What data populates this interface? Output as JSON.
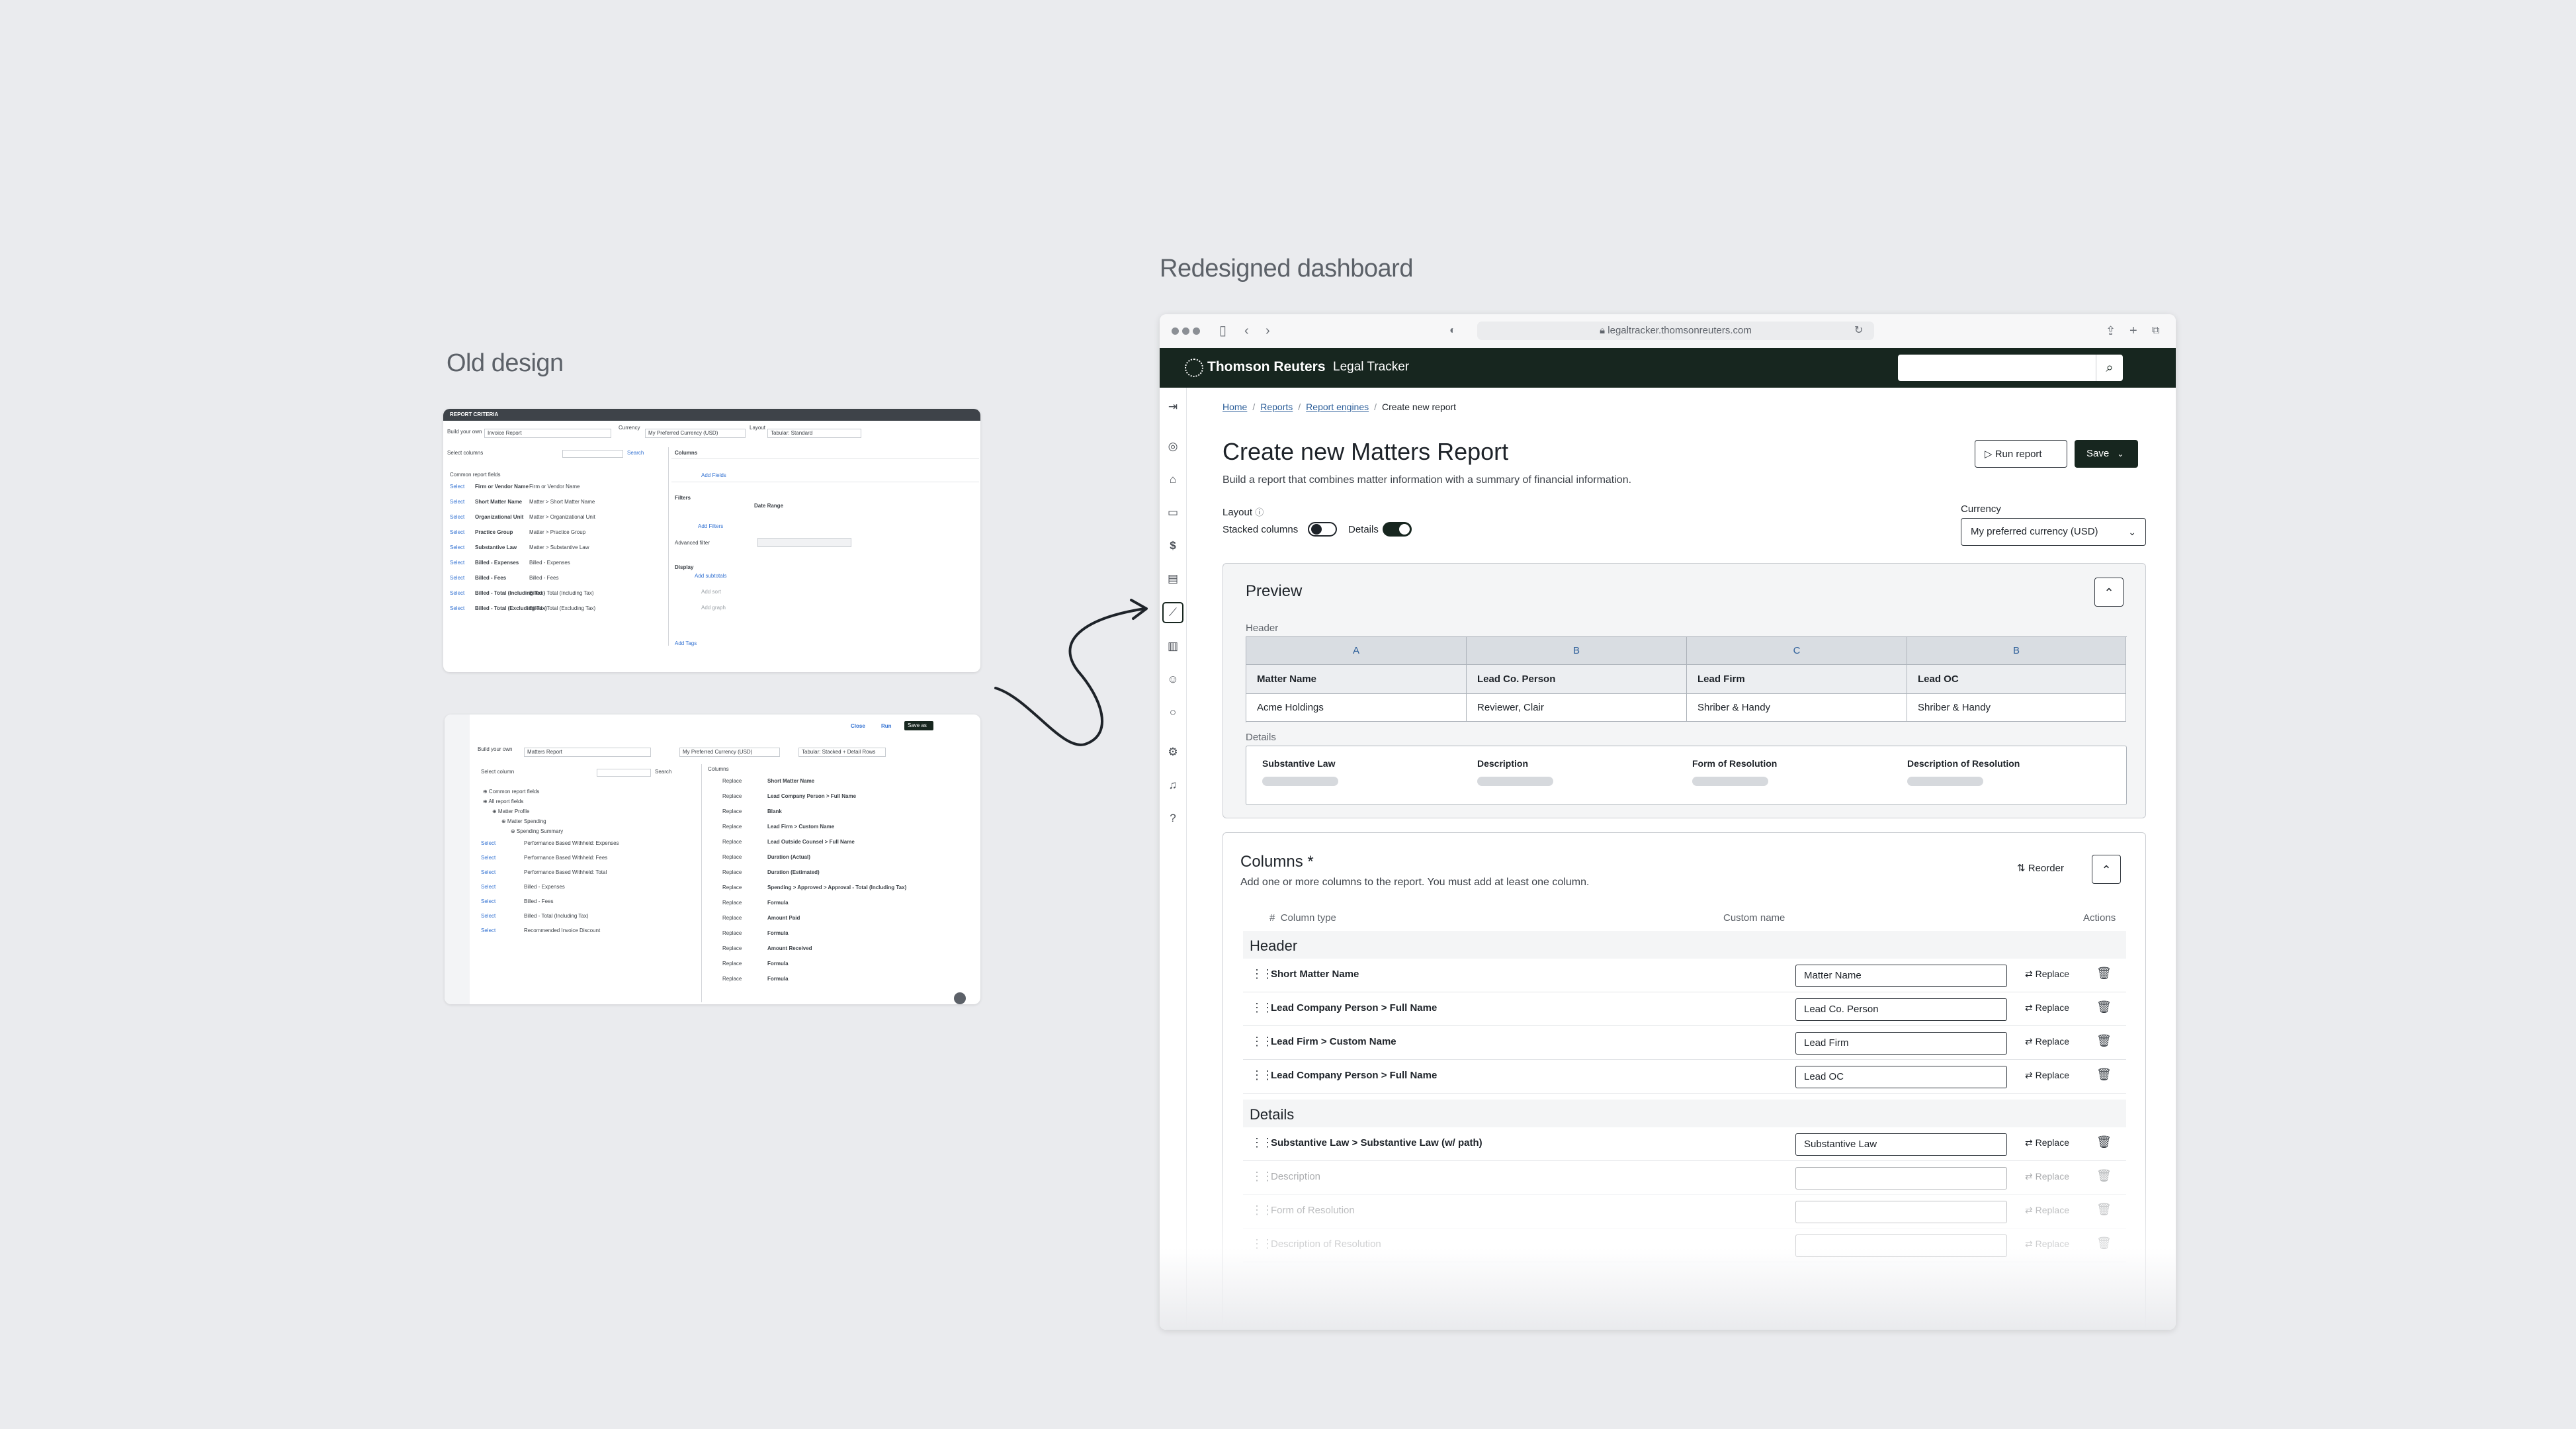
{
  "labels": {
    "old_design": "Old design",
    "redesigned": "Redesigned dashboard"
  },
  "old_top": {
    "header": "REPORT CRITERIA",
    "build_label": "Build your own",
    "report_value": "Invoice Report",
    "currency_label": "Currency",
    "currency_value": "My Preferred Currency (USD)",
    "layout_label": "Layout",
    "layout_value": "Tabular: Standard",
    "select_columns": "Select columns",
    "search": "Search",
    "common_fields": "Common report fields",
    "columns_label": "Columns",
    "add_fields": "Add Fields",
    "filters_label": "Filters",
    "date_range": "Date Range",
    "add_filters": "Add Filters",
    "advanced_filter": "Advanced filter",
    "display_label": "Display",
    "add_subtotals": "Add subtotals",
    "add_sort": "Add sort",
    "add_graph": "Add graph",
    "add_tags": "Add Tags",
    "rows": [
      {
        "name": "Firm or Vendor Name",
        "path": "Firm or Vendor Name"
      },
      {
        "name": "Short Matter Name",
        "path": "Matter > Short Matter Name"
      },
      {
        "name": "Organizational Unit",
        "path": "Matter > Organizational Unit"
      },
      {
        "name": "Practice Group",
        "path": "Matter > Practice Group"
      },
      {
        "name": "Substantive Law",
        "path": "Matter > Substantive Law"
      },
      {
        "name": "Billed - Expenses",
        "path": "Billed - Expenses"
      },
      {
        "name": "Billed - Fees",
        "path": "Billed - Fees"
      },
      {
        "name": "Billed - Total (Including Tax)",
        "path": "Billed - Total (Including Tax)"
      },
      {
        "name": "Billed - Total (Excluding Tax)",
        "path": "Billed - Total (Excluding Tax)"
      }
    ]
  },
  "old_bottom": {
    "close": "Close",
    "run": "Run",
    "save_as": "Save as",
    "build_label": "Build your own",
    "report_value": "Matters Report",
    "currency_value": "My Preferred Currency (USD)",
    "layout_value": "Tabular: Stacked + Detail Rows",
    "select_column": "Select column",
    "search": "Search",
    "tree": [
      "Common report fields",
      "All report fields",
      "Matter Profile",
      "Matter Spending",
      "Spending Summary"
    ],
    "left_rows": [
      "Performance Based Withheld: Expenses",
      "Performance Based Withheld: Fees",
      "Performance Based Withheld: Total",
      "Billed - Expenses",
      "Billed - Fees",
      "Billed - Total (Including Tax)",
      "Recommended Invoice Discount"
    ],
    "columns_label": "Columns",
    "replace": "Replace",
    "right_rows": [
      "Short Matter Name",
      "Lead Company Person > Full Name",
      "Blank",
      "Lead Firm > Custom Name",
      "Lead Outside Counsel > Full Name",
      "Duration (Actual)",
      "Duration (Estimated)",
      "Spending > Approved > Approval - Total (Including Tax)",
      "Formula",
      "Amount Paid",
      "Formula",
      "Amount Received",
      "Formula",
      "Formula"
    ]
  },
  "browser": {
    "url": "legaltracker.thomsonreuters.com",
    "brand": "Thomson Reuters",
    "app_name": "Legal Tracker",
    "search_placeholder": ""
  },
  "breadcrumb": [
    "Home",
    "Reports",
    "Report engines"
  ],
  "breadcrumb_current": "Create new report",
  "page": {
    "title": "Create new Matters Report",
    "subtitle": "Build a report that combines matter information with a summary of financial information.",
    "run_report": "Run report",
    "save": "Save",
    "layout_label": "Layout",
    "stacked_columns": "Stacked columns",
    "details": "Details",
    "currency_label": "Currency",
    "currency_value": "My preferred currency (USD)"
  },
  "preview": {
    "title": "Preview",
    "header_label": "Header",
    "letters": [
      "A",
      "B",
      "C",
      "B"
    ],
    "headers": [
      "Matter Name",
      "Lead Co. Person",
      "Lead Firm",
      "Lead OC"
    ],
    "values": [
      "Acme Holdings",
      "Reviewer, Clair",
      "Shriber & Handy",
      "Shriber & Handy"
    ],
    "details_label": "Details",
    "detail_headers": [
      "Substantive Law",
      "Description",
      "Form of Resolution",
      "Description of Resolution"
    ]
  },
  "columns": {
    "title": "Columns *",
    "subtitle": "Add one or more columns to the report. You must add at least one column.",
    "reorder": "Reorder",
    "col_type": "Column type",
    "hash": "#",
    "custom_name": "Custom name",
    "actions": "Actions",
    "header_group": "Header",
    "details_group": "Details",
    "replace": "Replace",
    "header_rows": [
      {
        "type": "Short Matter Name",
        "custom": "Matter Name"
      },
      {
        "type": "Lead Company Person > Full Name",
        "custom": "Lead Co. Person"
      },
      {
        "type": "Lead Firm > Custom Name",
        "custom": "Lead Firm"
      },
      {
        "type": "Lead Company Person > Full Name",
        "custom": "Lead OC"
      }
    ],
    "detail_rows": [
      {
        "type": "Substantive Law > Substantive Law (w/ path)",
        "custom": "Substantive Law"
      },
      {
        "type": "Description",
        "custom": ""
      },
      {
        "type": "Form of Resolution",
        "custom": ""
      },
      {
        "type": "Description of Resolution",
        "custom": ""
      }
    ]
  },
  "colors": {
    "brand_dark": "#17261f",
    "link": "#2d5f9a",
    "background": "#eaebee"
  },
  "icons": [
    "home-icon",
    "briefcase-icon",
    "dollar-icon",
    "book-icon",
    "chart-icon",
    "building-icon",
    "people-icon",
    "circle-icon",
    "gear-icon",
    "bell-icon",
    "help-icon",
    "search-icon",
    "trash-icon",
    "replace-icon",
    "drag-handle-icon"
  ]
}
